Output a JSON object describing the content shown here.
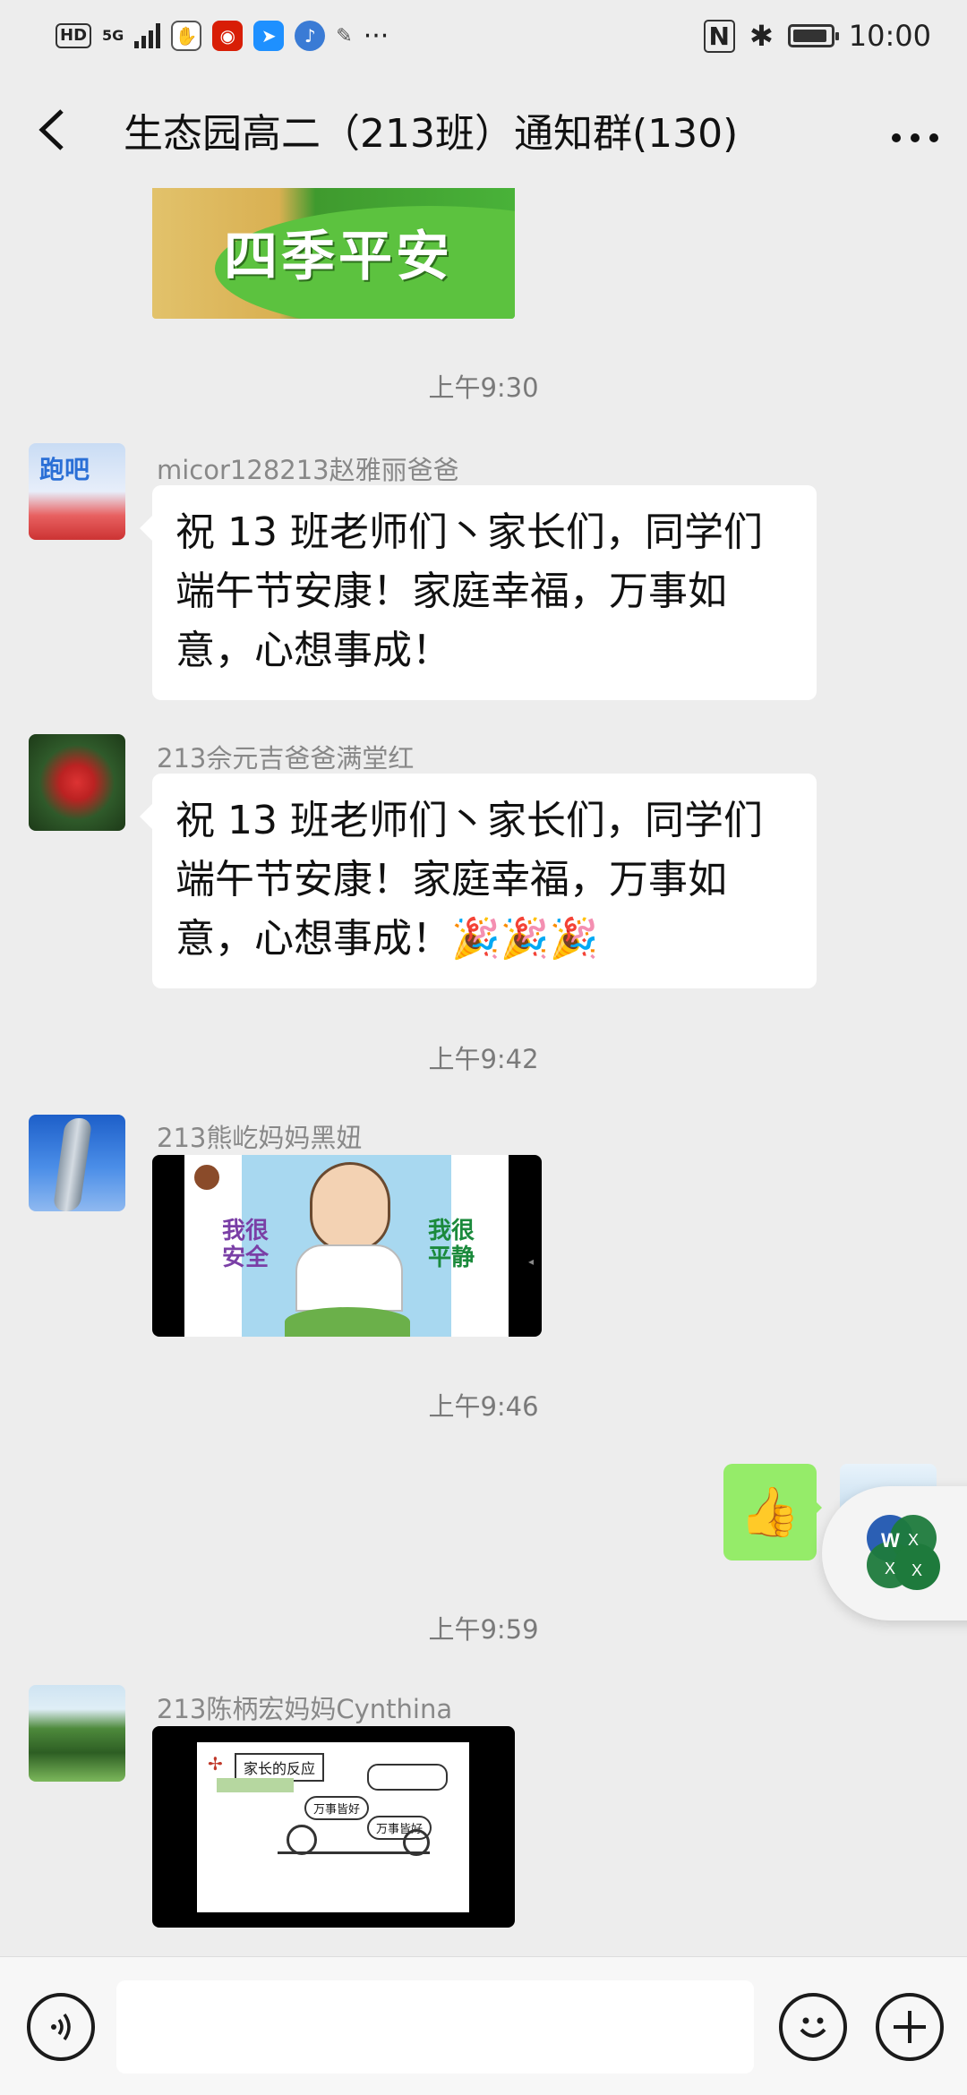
{
  "status_bar": {
    "hd": "HD",
    "network": "5G",
    "time": "10:00"
  },
  "header": {
    "title": "生态园高二（213班）通知群(130)",
    "back_icon": "chevron-left-icon",
    "more_icon": "more-dots-icon"
  },
  "banner_image": {
    "text": "四季平安"
  },
  "messages": {
    "t1": "上午9:30",
    "m1": {
      "sender": "micor128213赵雅丽爸爸",
      "text": "祝 13 班老师们丶家长们，同学们端午节安康！家庭幸福，万事如意，心想事成！"
    },
    "m2": {
      "sender": "213佘元吉爸爸满堂红",
      "text": "祝 13 班老师们丶家长们，同学们端午节安康！家庭幸福，万事如意，心想事成！",
      "emoji": "🎉🎉🎉"
    },
    "t2": "上午9:42",
    "m3": {
      "sender": "213熊屹妈妈黑妞",
      "video_left": "我很安全",
      "video_right": "我很平静"
    },
    "t3": "上午9:46",
    "m4": {
      "emoji": "👍"
    },
    "t4": "上午9:59",
    "m5": {
      "sender": "213陈柄宏妈妈Cynthina",
      "slide_title": "家长的反应",
      "bubble_a": "万事皆好",
      "bubble_b": "万事皆好"
    }
  },
  "colors": {
    "background": "#ededed",
    "self_bubble": "#95ec69",
    "video_bg": "#000000"
  }
}
